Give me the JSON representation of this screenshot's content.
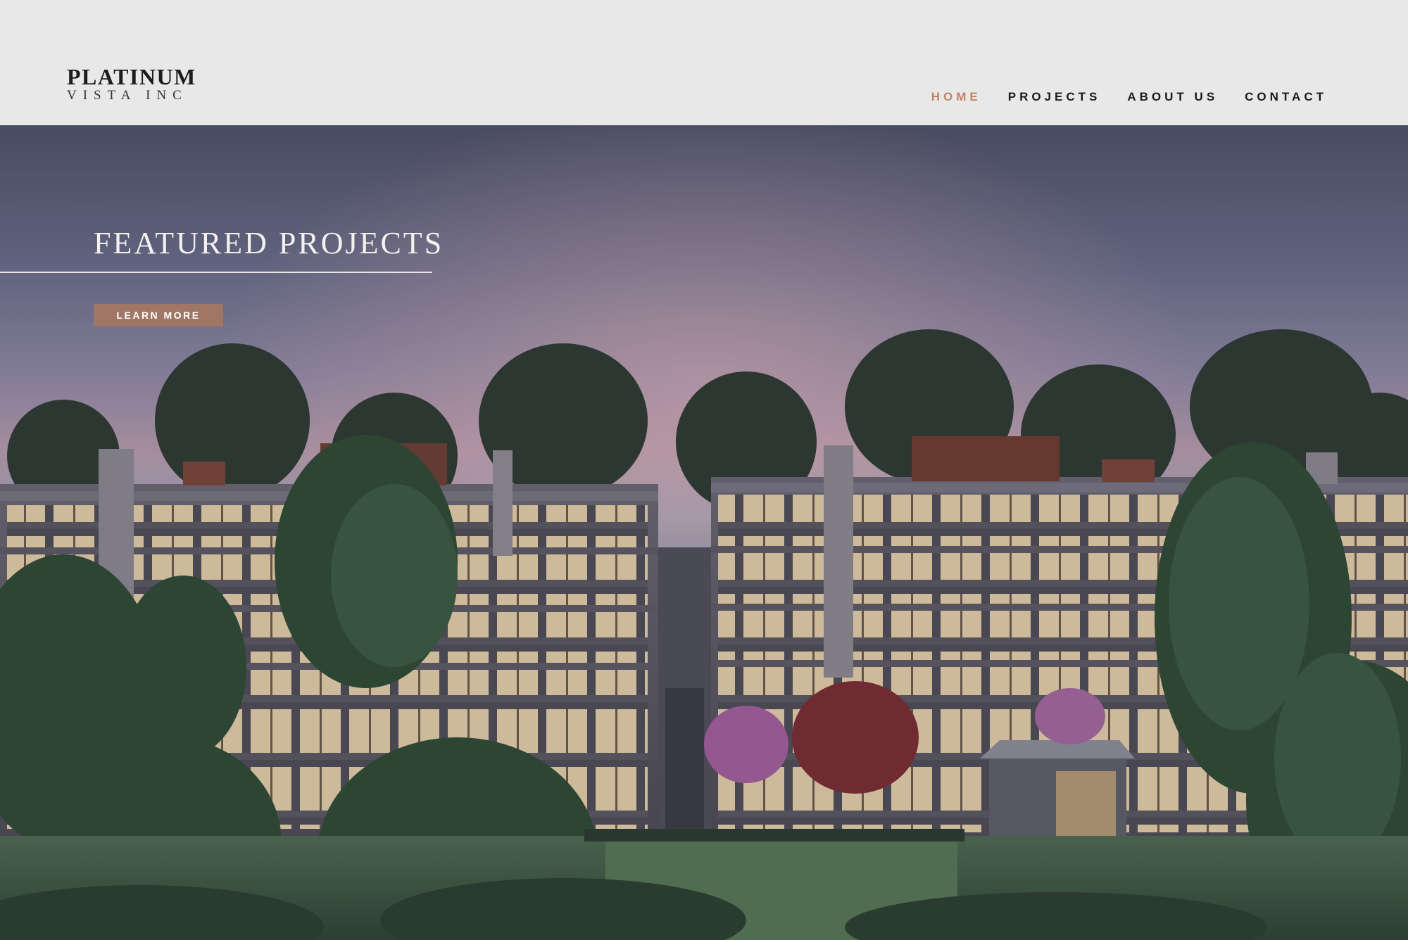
{
  "logo": {
    "line1": "PLATINUM",
    "line2": "VISTA INC"
  },
  "nav": {
    "items": [
      {
        "label": "HOME",
        "active": true
      },
      {
        "label": "PROJECTS",
        "active": false
      },
      {
        "label": "ABOUT US",
        "active": false
      },
      {
        "label": "CONTACT",
        "active": false
      }
    ]
  },
  "hero": {
    "title": "FEATURED PROJECTS",
    "button_label": "LEARN MORE"
  },
  "colors": {
    "header_bg": "#e8e8e8",
    "accent": "#c08462",
    "button_bg": "#a07767",
    "text_dark": "#1a1a1a"
  }
}
